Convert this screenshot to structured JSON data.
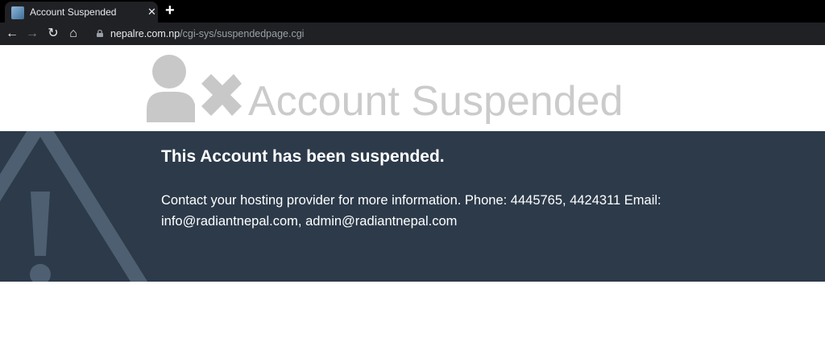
{
  "browser": {
    "tab_title": "Account Suspended",
    "tab_close": "✕",
    "new_tab": "+",
    "nav": {
      "back": "←",
      "forward": "→",
      "reload": "↻",
      "home": "⌂"
    },
    "url_host": "nepalre.com.np",
    "url_path": "/cgi-sys/suspendedpage.cgi"
  },
  "page": {
    "headline": "Account Suspended",
    "banner_title": "This Account has been suspended.",
    "banner_text": "Contact your hosting provider for more information. Phone: 4445765, 4424311 Email: info@radiantnepal.com, admin@radiantnepal.com"
  },
  "colors": {
    "banner_bg": "#2c3a4a",
    "headline_gray": "#cbcbcb",
    "icon_gray": "#c8c8c8"
  },
  "icons": {
    "user_icon": "user-with-x-icon",
    "warning_icon": "warning-triangle-icon"
  }
}
